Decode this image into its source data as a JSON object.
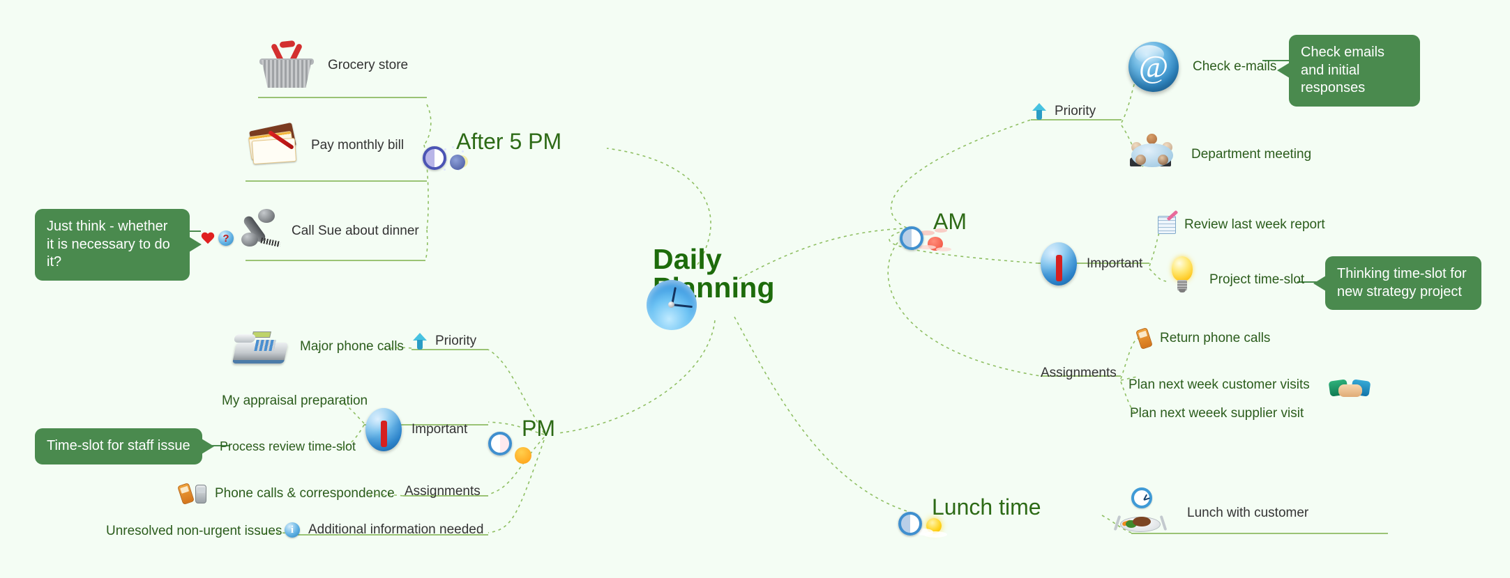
{
  "meta": {
    "background_color": "#f4fdf4",
    "accent_green": "#2d6a16",
    "callout_color": "#4a8a4e"
  },
  "root": {
    "title_line1": "Daily",
    "title_line2": "Planning",
    "icon": "clock-icon"
  },
  "branches": {
    "after5pm": {
      "label": "After 5 PM",
      "icon": "night-clock-icon",
      "topics": [
        {
          "label": "Grocery store",
          "icon": "shopping-basket-icon"
        },
        {
          "label": "Pay monthly bill",
          "icon": "bills-pen-icon"
        },
        {
          "label": "Call Sue about dinner",
          "icon": "telephone-handset-icon",
          "markers": [
            "heart-icon",
            "question-icon"
          ]
        }
      ],
      "callout": "Just think - whether it is necessary to do it?"
    },
    "am": {
      "label": "AM",
      "icon": "sunrise-clock-icon",
      "groups": [
        {
          "label": "Priority",
          "icon": "priority-arrow-icon",
          "topics": [
            {
              "label": "Check e-mails",
              "icon": "at-email-icon",
              "callout": "Check emails and initial responses"
            },
            {
              "label": "Department meeting",
              "icon": "meeting-table-icon"
            }
          ]
        },
        {
          "label": "Important",
          "icon": "important-exclamation-icon",
          "topics": [
            {
              "label": "Review last week report",
              "icon": "note-pencil-icon"
            },
            {
              "label": "Project time-slot",
              "icon": "lightbulb-icon",
              "callout": "Thinking time-slot for new strategy project"
            }
          ]
        },
        {
          "label": "Assignments",
          "icon": null,
          "topics": [
            {
              "label": "Return phone calls",
              "icon": "mobile-phone-icon"
            },
            {
              "label": "Plan next week customer visits",
              "icon": "handshake-icon"
            },
            {
              "label": "Plan next weeek supplier visit",
              "icon": null
            }
          ]
        }
      ]
    },
    "pm": {
      "label": "PM",
      "icon": "sunset-clock-icon",
      "groups": [
        {
          "label": "Priority",
          "icon": "priority-arrow-icon",
          "topics": [
            {
              "label": "Major phone calls",
              "icon": "desk-phone-icon"
            }
          ]
        },
        {
          "label": "Important",
          "icon": "important-exclamation-icon",
          "topics": [
            {
              "label": "My appraisal preparation",
              "icon": null
            },
            {
              "label": "Process review time-slot",
              "icon": null,
              "callout": "Time-slot for staff issue"
            }
          ]
        },
        {
          "label": "Assignments",
          "icon": null,
          "topics": [
            {
              "label": "Phone calls & correspondence",
              "icon": "mobile-phones-icon"
            }
          ]
        },
        {
          "label": "Additional  information needed",
          "icon": "info-icon",
          "topics": [
            {
              "label": "Unresolved non-urgent issues",
              "icon": null
            }
          ]
        }
      ]
    },
    "lunch": {
      "label": "Lunch time",
      "icon": "sun-clock-icon",
      "topics": [
        {
          "label": "Lunch with customer",
          "icon": "lunch-plate-icon",
          "extra_icon": "wall-clock-icon"
        }
      ]
    }
  }
}
